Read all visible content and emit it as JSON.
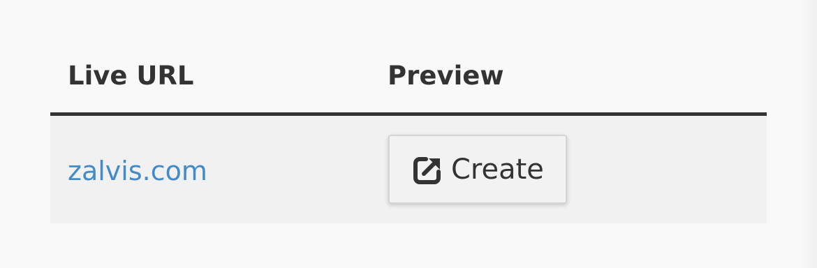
{
  "table": {
    "headers": {
      "live_url": "Live URL",
      "preview": "Preview"
    },
    "rows": [
      {
        "live_url": "zalvis.com",
        "preview_button": {
          "icon": "external-link-icon",
          "label": "Create"
        }
      }
    ]
  },
  "colors": {
    "link": "#428bca",
    "header_text": "#333333",
    "row_background": "#f1f1f1",
    "page_background": "#f9f9f9"
  }
}
